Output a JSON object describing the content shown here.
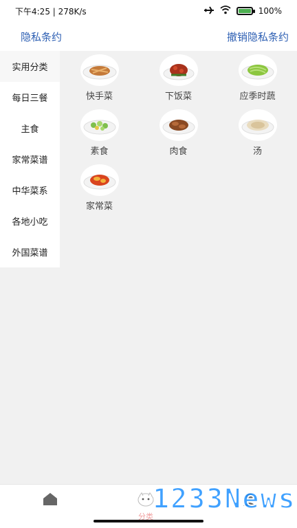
{
  "status_bar": {
    "time_speed": "下午4:25 | 278K/s",
    "battery": "100%",
    "battery_level": 1.0,
    "icons": [
      "airplane-icon",
      "wifi-icon",
      "battery-icon"
    ]
  },
  "top_nav": {
    "left_link": "隐私条约",
    "right_link": "撤销隐私条约",
    "link_color": "#2d5fb3"
  },
  "sidebar": {
    "items": [
      {
        "label": "实用分类"
      },
      {
        "label": "每日三餐"
      },
      {
        "label": "主食"
      },
      {
        "label": "家常菜谱"
      },
      {
        "label": "中华菜系"
      },
      {
        "label": "各地小吃"
      },
      {
        "label": "外国菜谱"
      }
    ]
  },
  "dishes": [
    {
      "label": "快手菜",
      "icon": "dish-quick-icon"
    },
    {
      "label": "下饭菜",
      "icon": "dish-rice-companion-icon"
    },
    {
      "label": "应季时蔬",
      "icon": "dish-seasonal-veg-icon"
    },
    {
      "label": "素食",
      "icon": "dish-vegetarian-icon"
    },
    {
      "label": "肉食",
      "icon": "dish-meat-icon"
    },
    {
      "label": "汤",
      "icon": "dish-soup-icon"
    },
    {
      "label": "家常菜",
      "icon": "dish-home-style-icon"
    }
  ],
  "tab_bar": {
    "tabs": [
      {
        "icon": "home-icon"
      },
      {
        "label": "分类",
        "icon": "category-icon"
      },
      {
        "icon": "profile-icon"
      }
    ]
  },
  "watermark": {
    "text": "1233News"
  }
}
